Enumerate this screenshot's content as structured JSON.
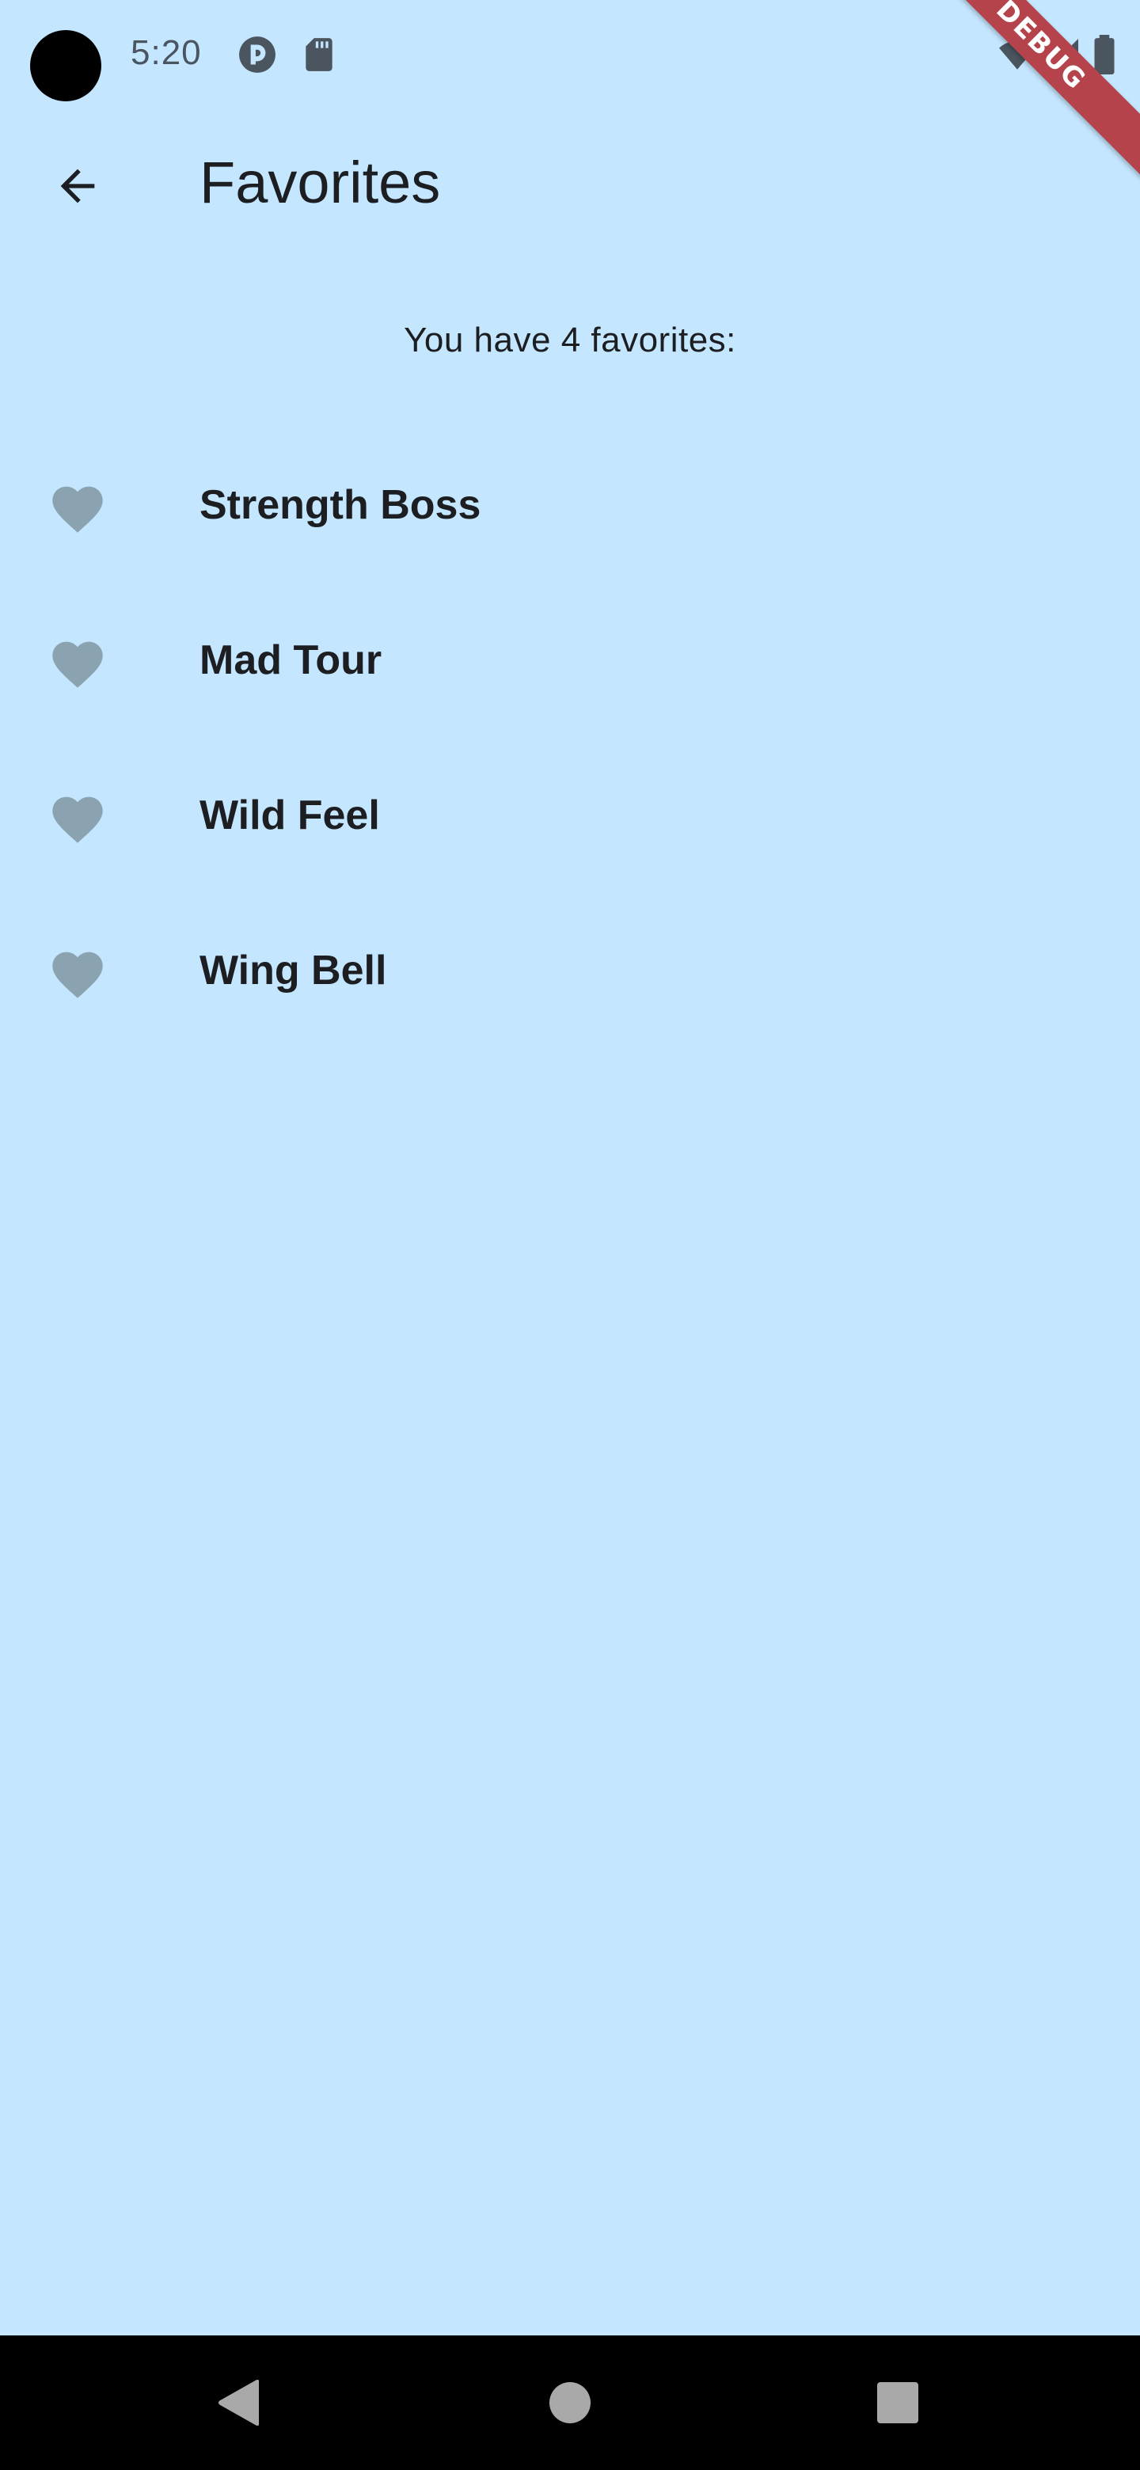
{
  "status_bar": {
    "time": "5:20",
    "icons": [
      "pocket-casts-icon",
      "sd-card-icon",
      "wifi-icon",
      "signal-icon",
      "battery-icon"
    ],
    "debug_banner": "DEBUG"
  },
  "app_bar": {
    "back_icon": "arrow-back-icon",
    "title": "Favorites"
  },
  "content": {
    "count_text": "You have 4 favorites:",
    "favorites": [
      {
        "label": "Strength Boss",
        "icon": "heart-icon"
      },
      {
        "label": "Mad Tour",
        "icon": "heart-icon"
      },
      {
        "label": "Wild Feel",
        "icon": "heart-icon"
      },
      {
        "label": "Wing Bell",
        "icon": "heart-icon"
      }
    ]
  },
  "nav_bar": {
    "buttons": [
      "back-triangle-icon",
      "home-circle-icon",
      "recents-square-icon"
    ]
  },
  "colors": {
    "background": "#C4E7FF",
    "heart": "#8BA2B0",
    "text": "#1C1E22",
    "debug_ribbon": "#B5434B"
  }
}
